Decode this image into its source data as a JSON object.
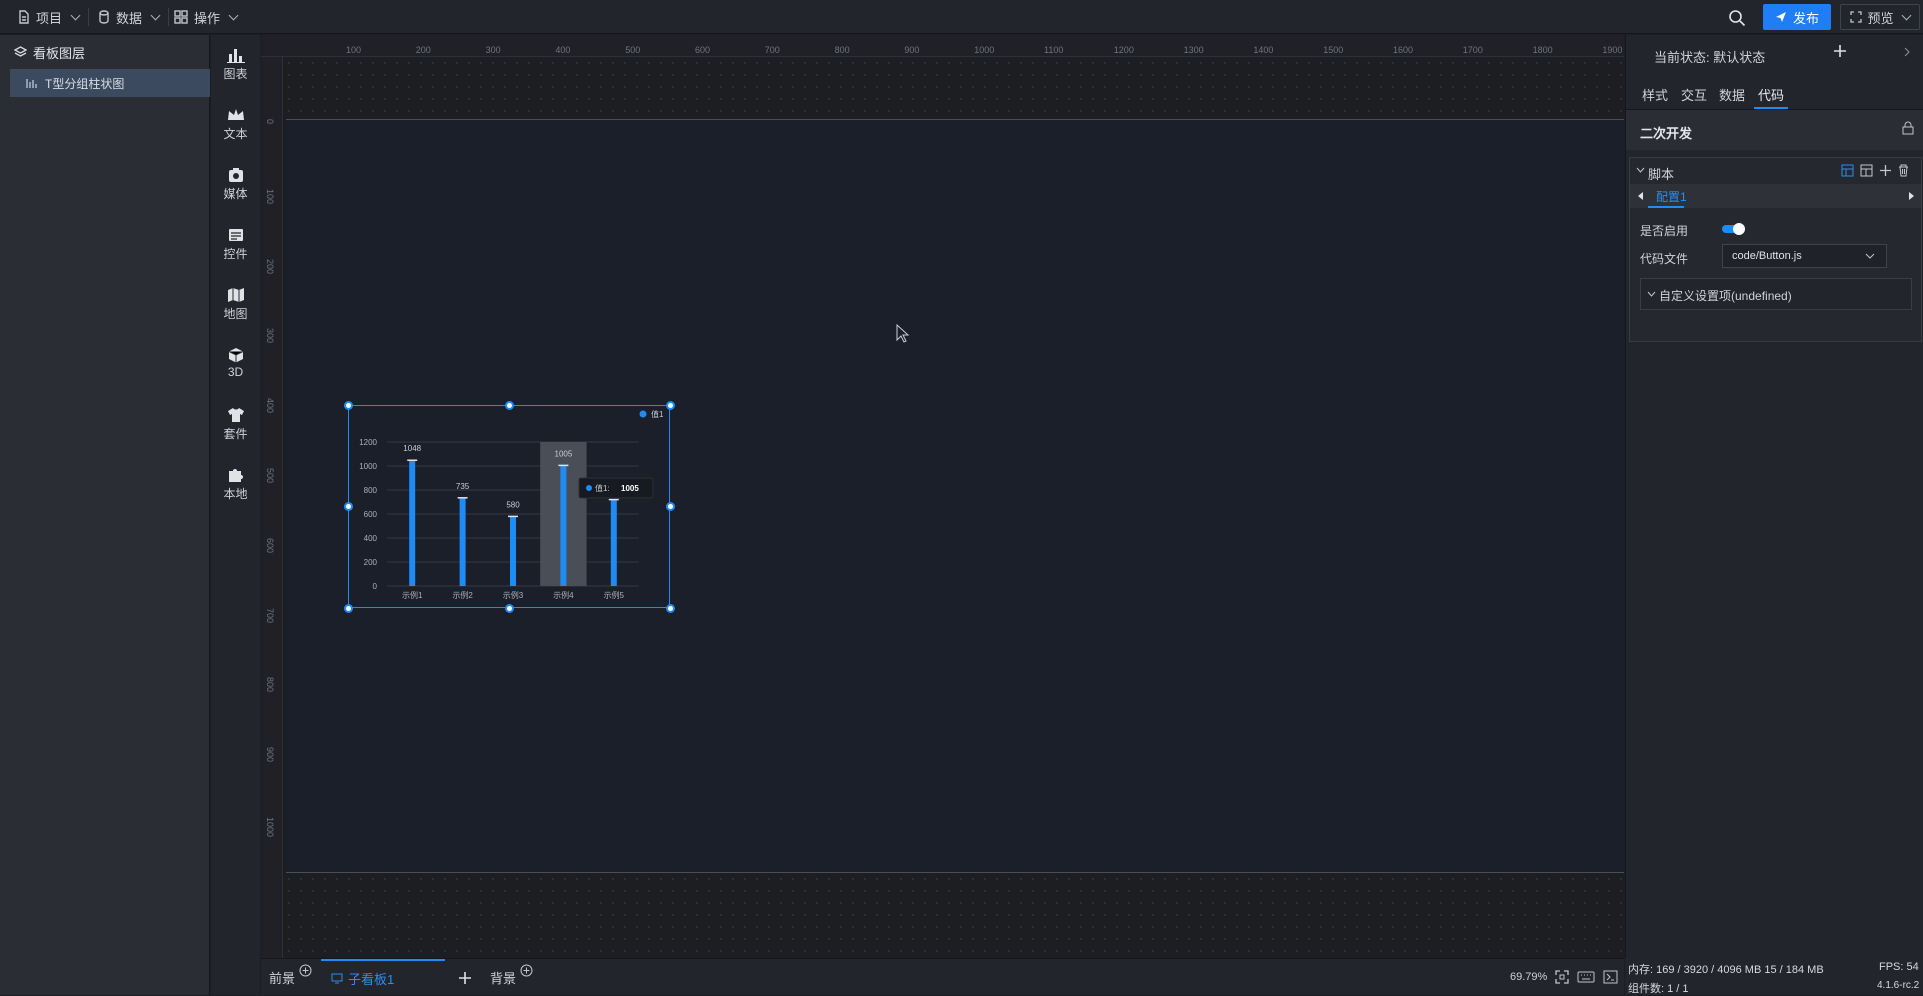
{
  "topbar": {
    "menus": [
      {
        "label": "项目",
        "icon": "file-icon"
      },
      {
        "label": "数据",
        "icon": "database-icon"
      },
      {
        "label": "操作",
        "icon": "grid-icon"
      }
    ],
    "publish_label": "发布",
    "preview_label": "预览"
  },
  "layers": {
    "title": "看板图层",
    "items": [
      {
        "label": "T型分组柱状图",
        "icon": "bar-chart-icon"
      }
    ]
  },
  "components": [
    {
      "label": "图表",
      "icon": "chart-icon"
    },
    {
      "label": "文本",
      "icon": "crown-icon"
    },
    {
      "label": "媒体",
      "icon": "media-icon"
    },
    {
      "label": "控件",
      "icon": "control-icon"
    },
    {
      "label": "地图",
      "icon": "map-icon"
    },
    {
      "label": "3D",
      "icon": "cube-icon"
    },
    {
      "label": "套件",
      "icon": "shirt-icon"
    },
    {
      "label": "本地",
      "icon": "puzzle-icon"
    }
  ],
  "rulers": {
    "top_ticks": [
      "100",
      "200",
      "300",
      "400",
      "500",
      "600",
      "700",
      "800",
      "900",
      "1000",
      "1100",
      "1200",
      "1300",
      "1400",
      "1500",
      "1600",
      "1700",
      "1800",
      "1900"
    ],
    "left_ticks": [
      "0",
      "100",
      "200",
      "300",
      "400",
      "500",
      "600",
      "700",
      "800",
      "900",
      "1000"
    ]
  },
  "chart_data": {
    "type": "bar",
    "categories": [
      "示例1",
      "示例2",
      "示例3",
      "示例4",
      "示例5"
    ],
    "series": [
      {
        "name": "值1",
        "values": [
          1048,
          735,
          580,
          1005,
          720
        ]
      }
    ],
    "data_labels": [
      "1048",
      "735",
      "580",
      "1005",
      ""
    ],
    "ylim": [
      0,
      1200
    ],
    "yticks": [
      "0",
      "200",
      "400",
      "600",
      "800",
      "1000",
      "1200"
    ],
    "highlight_index": 3,
    "tooltip": {
      "label": "值1:",
      "value": "1005"
    },
    "legend_position": "top-right",
    "color": "#1f8cf5"
  },
  "bottom": {
    "tabs": [
      "前景",
      "子看板1",
      "背景"
    ],
    "zoom": "69.79%"
  },
  "right": {
    "state_label": "当前状态:",
    "state_value": "默认状态",
    "tabs": [
      "样式",
      "交互",
      "数据",
      "代码"
    ],
    "active_tab": "代码",
    "section_title": "二次开发",
    "script_title": "脚本",
    "config_tab": "配置1",
    "enable_label": "是否启用",
    "enabled": true,
    "code_file_label": "代码文件",
    "code_file_value": "code/Button.js",
    "custom_settings": "自定义设置项(undefined)"
  },
  "status": {
    "memory": "内存: 169 / 3920 / 4096 MB  15 / 184 MB",
    "fps": "FPS: 54",
    "components": "组件数: 1 / 1",
    "version": "4.1.6-rc.2"
  }
}
